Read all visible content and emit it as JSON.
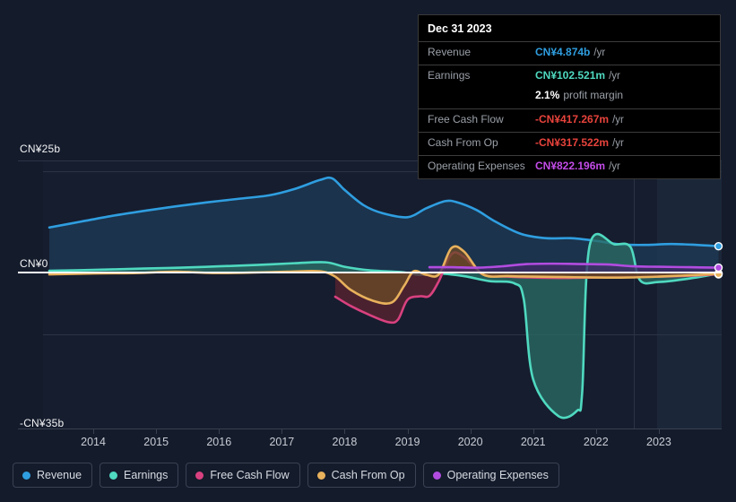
{
  "tooltip": {
    "title": "Dec 31 2023",
    "rows": [
      {
        "label": "Revenue",
        "value": "CN¥4.874b",
        "unit": "/yr",
        "color": "#2f9ee0"
      },
      {
        "label": "Earnings",
        "value": "CN¥102.521m",
        "unit": "/yr",
        "color": "#4fd9c0"
      },
      {
        "label": "Free Cash Flow",
        "value": "-CN¥417.267m",
        "unit": "/yr",
        "color": "#e8433c"
      },
      {
        "label": "Cash From Op",
        "value": "-CN¥317.522m",
        "unit": "/yr",
        "color": "#e8433c"
      },
      {
        "label": "Operating Expenses",
        "value": "CN¥822.196m",
        "unit": "/yr",
        "color": "#c34ce8"
      }
    ],
    "margin_value": "2.1%",
    "margin_label": "profit margin"
  },
  "legend": {
    "items": [
      {
        "label": "Revenue",
        "color": "#2f9ee0"
      },
      {
        "label": "Earnings",
        "color": "#4fd9c0"
      },
      {
        "label": "Free Cash Flow",
        "color": "#d8417f"
      },
      {
        "label": "Cash From Op",
        "color": "#e8b15c"
      },
      {
        "label": "Operating Expenses",
        "color": "#b24ce0"
      }
    ]
  },
  "chart_data": {
    "type": "area",
    "title": "",
    "xlabel": "",
    "ylabel": "",
    "xlim": [
      2013.2,
      2024.0
    ],
    "ylim": [
      -35,
      25
    ],
    "grid": true,
    "legend_position": "bottom",
    "currency": "CN¥",
    "y_ticks": [
      {
        "value": 25,
        "label": "CN¥25b"
      },
      {
        "value": 0,
        "label": "CN¥0"
      },
      {
        "value": -35,
        "label": "-CN¥35b"
      }
    ],
    "x_ticks": [
      {
        "value": 2014,
        "label": "2014"
      },
      {
        "value": 2015,
        "label": "2015"
      },
      {
        "value": 2016,
        "label": "2016"
      },
      {
        "value": 2017,
        "label": "2017"
      },
      {
        "value": 2018,
        "label": "2018"
      },
      {
        "value": 2019,
        "label": "2019"
      },
      {
        "value": 2020,
        "label": "2020"
      },
      {
        "value": 2021,
        "label": "2021"
      },
      {
        "value": 2022,
        "label": "2022"
      },
      {
        "value": 2023,
        "label": "2023"
      }
    ],
    "highlight_region": {
      "from": 2022.6,
      "to": 2024.0,
      "label": ""
    },
    "series": [
      {
        "name": "Revenue",
        "color": "#2f9ee0",
        "fill": "#1d3a55",
        "x": [
          2013.3,
          2013.8,
          2014.3,
          2014.8,
          2015.3,
          2015.8,
          2016.3,
          2016.8,
          2017.2,
          2017.6,
          2017.8,
          2018.0,
          2018.3,
          2018.6,
          2019.0,
          2019.3,
          2019.6,
          2019.8,
          2020.1,
          2020.4,
          2020.8,
          2021.2,
          2021.6,
          2022.0,
          2022.4,
          2022.8,
          2023.2,
          2023.6,
          2023.95
        ],
        "y": [
          10.0,
          11.3,
          12.6,
          13.7,
          14.7,
          15.6,
          16.4,
          17.2,
          18.6,
          20.6,
          21.0,
          18.4,
          15.0,
          13.2,
          12.3,
          14.3,
          15.9,
          15.6,
          13.9,
          11.3,
          8.6,
          7.6,
          7.6,
          7.0,
          6.2,
          6.1,
          6.3,
          6.1,
          5.8
        ]
      },
      {
        "name": "Earnings",
        "color": "#4fd9c0",
        "fill": "#2a6a63",
        "x": [
          2013.3,
          2014.0,
          2014.8,
          2015.4,
          2016.0,
          2016.6,
          2017.2,
          2017.7,
          2018.0,
          2018.4,
          2018.9,
          2019.2,
          2019.5,
          2019.9,
          2020.3,
          2020.7,
          2020.85,
          2021.0,
          2021.4,
          2021.7,
          2021.78,
          2021.9,
          2022.3,
          2022.55,
          2022.7,
          2023.0,
          2023.5,
          2023.95
        ],
        "y": [
          0.3,
          0.5,
          0.8,
          1.0,
          1.3,
          1.6,
          2.0,
          2.2,
          1.2,
          0.4,
          0.0,
          -0.6,
          -0.3,
          -0.9,
          -2.0,
          -2.5,
          -6.0,
          -24.0,
          -32.2,
          -31.0,
          -27.0,
          6.0,
          6.2,
          5.6,
          -1.8,
          -2.2,
          -1.4,
          -0.3
        ]
      },
      {
        "name": "Free Cash Flow",
        "color": "#d8417f",
        "fill": "#5a2230",
        "x": [
          2017.85,
          2018.1,
          2018.4,
          2018.7,
          2018.85,
          2019.0,
          2019.2,
          2019.35,
          2019.5,
          2019.7,
          2019.9,
          2020.2,
          2020.6,
          2021.0,
          2021.5,
          2022.0,
          2022.5,
          2023.0,
          2023.5,
          2023.95
        ],
        "y": [
          -5.5,
          -7.6,
          -9.6,
          -11.2,
          -10.6,
          -6.2,
          -5.4,
          -5.3,
          -2.0,
          4.0,
          3.4,
          -0.5,
          -1.0,
          -1.2,
          -1.3,
          -1.2,
          -1.1,
          -1.0,
          -0.8,
          -0.5
        ]
      },
      {
        "name": "Cash From Op",
        "color": "#e8b15c",
        "fill": "#6a4a28",
        "x": [
          2013.3,
          2014.0,
          2014.7,
          2015.3,
          2015.9,
          2016.5,
          2017.1,
          2017.6,
          2017.85,
          2018.1,
          2018.45,
          2018.75,
          2018.95,
          2019.1,
          2019.3,
          2019.5,
          2019.7,
          2019.9,
          2020.2,
          2020.6,
          2021.0,
          2021.5,
          2022.0,
          2022.5,
          2023.0,
          2023.5,
          2023.95
        ],
        "y": [
          -0.5,
          -0.3,
          -0.2,
          0.1,
          -0.2,
          -0.1,
          0.1,
          0.2,
          -1.0,
          -4.0,
          -6.4,
          -6.8,
          -3.0,
          0.2,
          -0.6,
          -0.5,
          5.4,
          4.6,
          -0.5,
          -0.9,
          -1.0,
          -1.1,
          -1.2,
          -1.2,
          -1.0,
          -0.7,
          -0.4
        ]
      },
      {
        "name": "Operating Expenses",
        "color": "#b24ce0",
        "fill": "#3d2a66",
        "x": [
          2019.35,
          2019.7,
          2020.1,
          2020.5,
          2020.9,
          2021.3,
          2021.8,
          2022.2,
          2022.6,
          2023.0,
          2023.5,
          2023.95
        ],
        "y": [
          1.1,
          1.1,
          1.0,
          1.3,
          1.8,
          1.9,
          1.8,
          1.7,
          1.3,
          1.2,
          1.1,
          1.0
        ]
      }
    ]
  }
}
